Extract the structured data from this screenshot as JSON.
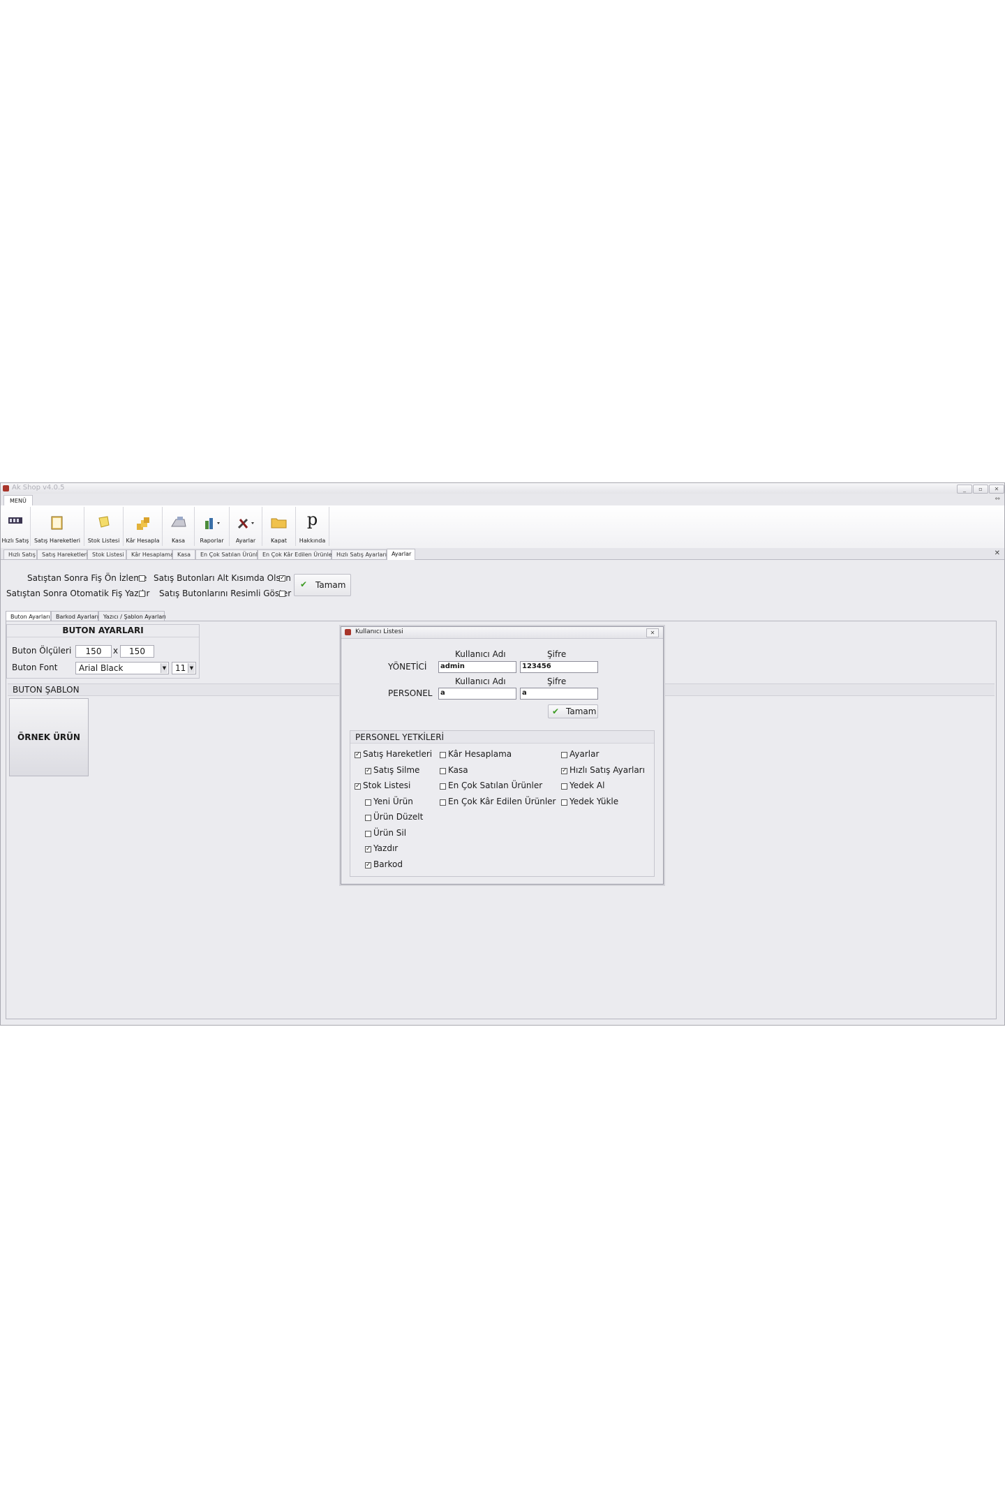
{
  "window": {
    "title": "Ak Shop v4.0.5",
    "controls": [
      "_",
      "▫",
      "✕"
    ]
  },
  "menu_tab": "MENÜ",
  "ribbon": [
    {
      "label": "Hızlı Satış",
      "icon": "register-icon"
    },
    {
      "label": "Satış Hareketleri",
      "icon": "book-icon"
    },
    {
      "label": "Stok Listesi",
      "icon": "note-icon"
    },
    {
      "label": "Kâr Hesapla",
      "icon": "coins-icon"
    },
    {
      "label": "Kasa",
      "icon": "cash-register-icon"
    },
    {
      "label": "Raporlar",
      "icon": "report-icon"
    },
    {
      "label": "Ayarlar",
      "icon": "tools-icon"
    },
    {
      "label": "Kapat",
      "icon": "folder-icon"
    },
    {
      "label": "Hakkında",
      "icon": "about-p-icon"
    }
  ],
  "doc_tabs": [
    "Hızlı Satış",
    "Satış Hareketleri",
    "Stok Listesi",
    "Kâr Hesaplama",
    "Kasa",
    "En Çok Satılan Ürünler",
    "En Çok Kâr Edilen Ürünler",
    "Hızlı Satış Ayarları",
    "Ayarlar"
  ],
  "settings": {
    "opt1": "Satıştan Sonra Fiş Ön İzleme",
    "opt2": "Satıştan Sonra Otomatik Fiş Yazdır",
    "opt3": "Satış Butonları Alt Kısımda Olsun",
    "opt4": "Satış Butonlarını Resimli Göster",
    "opt1_checked": false,
    "opt2_checked": false,
    "opt3_checked": true,
    "opt4_checked": false,
    "ok_label": "Tamam"
  },
  "sub_tabs": [
    "Buton Ayarları",
    "Barkod Ayarları",
    "Yazıcı / Şablon Ayarları"
  ],
  "buton_ayarlari": {
    "header": "BUTON AYARLARI",
    "size_label": "Buton Ölçüleri",
    "width": "150",
    "x": "x",
    "height": "150",
    "font_label": "Buton Font",
    "font_value": "Arial Black",
    "font_size": "11"
  },
  "sablon": {
    "header": "BUTON ŞABLON",
    "sample_label": "ÖRNEK ÜRÜN"
  },
  "dialog": {
    "title": "Kullanıcı Listesi",
    "col_user": "Kullanıcı Adı",
    "col_pass": "Şifre",
    "admin_label": "YÖNETİCİ",
    "admin_user": "admin",
    "admin_pass": "123456",
    "staff_label": "PERSONEL",
    "staff_user": "a",
    "staff_pass": "a",
    "ok_label": "Tamam",
    "perm_header": "PERSONEL YETKİLERİ",
    "perms_col1": [
      {
        "label": "Satış Hareketleri",
        "checked": true,
        "indent": false
      },
      {
        "label": "Satış Silme",
        "checked": true,
        "indent": true
      },
      {
        "label": "Stok Listesi",
        "checked": true,
        "indent": false
      },
      {
        "label": "Yeni Ürün",
        "checked": false,
        "indent": true
      },
      {
        "label": "Ürün Düzelt",
        "checked": false,
        "indent": true
      },
      {
        "label": "Ürün Sil",
        "checked": false,
        "indent": true
      },
      {
        "label": "Yazdır",
        "checked": true,
        "indent": true
      },
      {
        "label": "Barkod",
        "checked": true,
        "indent": true
      }
    ],
    "perms_col2": [
      {
        "label": "Kâr Hesaplama",
        "checked": false
      },
      {
        "label": "Kasa",
        "checked": false
      },
      {
        "label": "En Çok Satılan Ürünler",
        "checked": false
      },
      {
        "label": "En Çok Kâr Edilen Ürünler",
        "checked": false
      }
    ],
    "perms_col3": [
      {
        "label": "Ayarlar",
        "checked": false
      },
      {
        "label": "Hızlı Satış Ayarları",
        "checked": true
      },
      {
        "label": "Yedek Al",
        "checked": false
      },
      {
        "label": "Yedek Yükle",
        "checked": false
      }
    ]
  }
}
